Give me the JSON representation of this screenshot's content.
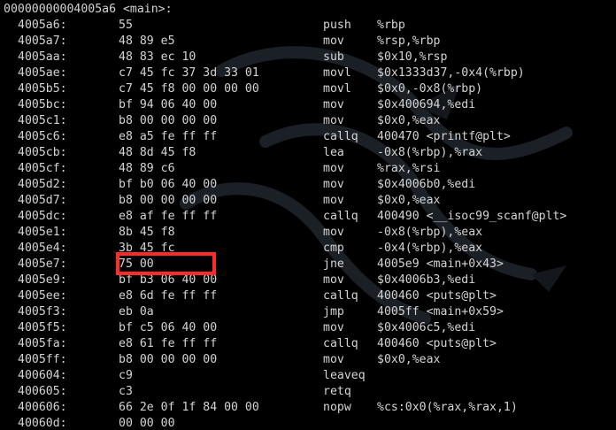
{
  "header": "00000000004005a6 <main>:",
  "rows": [
    {
      "addr": "4005a6:",
      "bytes": "55",
      "mnem": "push",
      "ops": "%rbp"
    },
    {
      "addr": "4005a7:",
      "bytes": "48 89 e5",
      "mnem": "mov",
      "ops": "%rsp,%rbp"
    },
    {
      "addr": "4005aa:",
      "bytes": "48 83 ec 10",
      "mnem": "sub",
      "ops": "$0x10,%rsp"
    },
    {
      "addr": "4005ae:",
      "bytes": "c7 45 fc 37 3d 33 01",
      "mnem": "movl",
      "ops": "$0x1333d37,-0x4(%rbp)"
    },
    {
      "addr": "4005b5:",
      "bytes": "c7 45 f8 00 00 00 00",
      "mnem": "movl",
      "ops": "$0x0,-0x8(%rbp)"
    },
    {
      "addr": "4005bc:",
      "bytes": "bf 94 06 40 00",
      "mnem": "mov",
      "ops": "$0x400694,%edi"
    },
    {
      "addr": "4005c1:",
      "bytes": "b8 00 00 00 00",
      "mnem": "mov",
      "ops": "$0x0,%eax"
    },
    {
      "addr": "4005c6:",
      "bytes": "e8 a5 fe ff ff",
      "mnem": "callq",
      "ops": "400470 <printf@plt>"
    },
    {
      "addr": "4005cb:",
      "bytes": "48 8d 45 f8",
      "mnem": "lea",
      "ops": "-0x8(%rbp),%rax"
    },
    {
      "addr": "4005cf:",
      "bytes": "48 89 c6",
      "mnem": "mov",
      "ops": "%rax,%rsi"
    },
    {
      "addr": "4005d2:",
      "bytes": "bf b0 06 40 00",
      "mnem": "mov",
      "ops": "$0x4006b0,%edi"
    },
    {
      "addr": "4005d7:",
      "bytes": "b8 00 00 00 00",
      "mnem": "mov",
      "ops": "$0x0,%eax"
    },
    {
      "addr": "4005dc:",
      "bytes": "e8 af fe ff ff",
      "mnem": "callq",
      "ops": "400490 <__isoc99_scanf@plt>"
    },
    {
      "addr": "4005e1:",
      "bytes": "8b 45 f8",
      "mnem": "mov",
      "ops": "-0x8(%rbp),%eax"
    },
    {
      "addr": "4005e4:",
      "bytes": "3b 45 fc",
      "mnem": "cmp",
      "ops": "-0x4(%rbp),%eax"
    },
    {
      "addr": "4005e7:",
      "bytes": "75 00",
      "mnem": "jne",
      "ops": "4005e9 <main+0x43>"
    },
    {
      "addr": "4005e9:",
      "bytes": "bf b3 06 40 00",
      "mnem": "mov",
      "ops": "$0x4006b3,%edi"
    },
    {
      "addr": "4005ee:",
      "bytes": "e8 6d fe ff ff",
      "mnem": "callq",
      "ops": "400460 <puts@plt>"
    },
    {
      "addr": "4005f3:",
      "bytes": "eb 0a",
      "mnem": "jmp",
      "ops": "4005ff <main+0x59>"
    },
    {
      "addr": "4005f5:",
      "bytes": "bf c5 06 40 00",
      "mnem": "mov",
      "ops": "$0x4006c5,%edi"
    },
    {
      "addr": "4005fa:",
      "bytes": "e8 61 fe ff ff",
      "mnem": "callq",
      "ops": "400460 <puts@plt>"
    },
    {
      "addr": "4005ff:",
      "bytes": "b8 00 00 00 00",
      "mnem": "mov",
      "ops": "$0x0,%eax"
    },
    {
      "addr": "400604:",
      "bytes": "c9",
      "mnem": "leaveq",
      "ops": ""
    },
    {
      "addr": "400605:",
      "bytes": "c3",
      "mnem": "retq",
      "ops": ""
    },
    {
      "addr": "400606:",
      "bytes": "66 2e 0f 1f 84 00 00",
      "mnem": "nopw",
      "ops": "%cs:0x0(%rax,%rax,1)"
    },
    {
      "addr": "40060d:",
      "bytes": "00 00 00",
      "mnem": "",
      "ops": ""
    }
  ],
  "highlight": {
    "row_index": 15,
    "color": "#ff2b2b"
  },
  "colors": {
    "background": "#000000",
    "text": "#d4d4d4",
    "watermark": "#1a1f24"
  },
  "icons": {
    "background": "dragon-watermark-icon"
  }
}
